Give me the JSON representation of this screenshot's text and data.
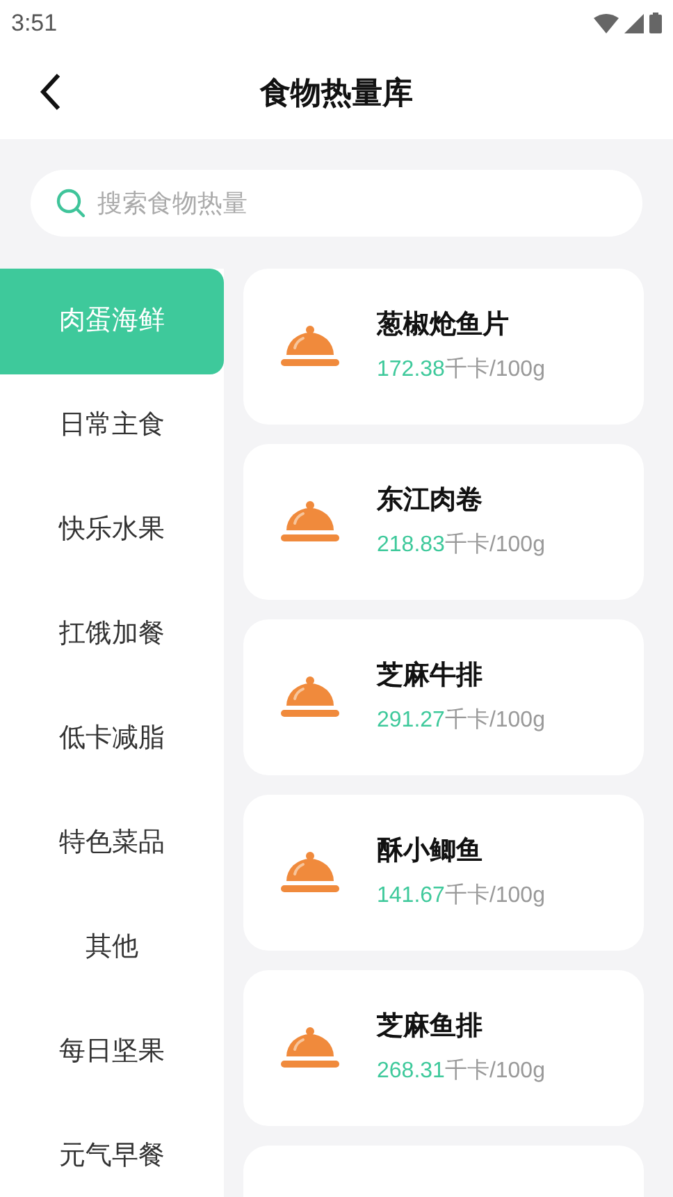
{
  "status_bar": {
    "time": "3:51"
  },
  "header": {
    "title": "食物热量库"
  },
  "search": {
    "placeholder": "搜索食物热量"
  },
  "categories": [
    {
      "label": "肉蛋海鲜",
      "selected": true
    },
    {
      "label": "日常主食",
      "selected": false
    },
    {
      "label": "快乐水果",
      "selected": false
    },
    {
      "label": "扛饿加餐",
      "selected": false
    },
    {
      "label": "低卡减脂",
      "selected": false
    },
    {
      "label": "特色菜品",
      "selected": false
    },
    {
      "label": "其他",
      "selected": false
    },
    {
      "label": "每日坚果",
      "selected": false
    },
    {
      "label": "元气早餐",
      "selected": false
    }
  ],
  "foods": [
    {
      "name": "葱椒炝鱼片",
      "calories": "172.38",
      "unit": "千卡/100g"
    },
    {
      "name": "东江肉卷",
      "calories": "218.83",
      "unit": "千卡/100g"
    },
    {
      "name": "芝麻牛排",
      "calories": "291.27",
      "unit": "千卡/100g"
    },
    {
      "name": "酥小鲫鱼",
      "calories": "141.67",
      "unit": "千卡/100g"
    },
    {
      "name": "芝麻鱼排",
      "calories": "268.31",
      "unit": "千卡/100g"
    }
  ]
}
